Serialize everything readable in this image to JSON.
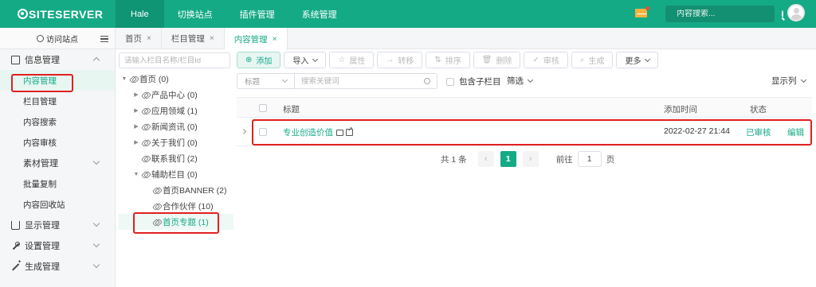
{
  "topbar": {
    "logo": "SITESERVER",
    "nav": [
      "Hale",
      "切换站点",
      "插件管理",
      "系统管理"
    ],
    "search_placeholder": "内容搜索..."
  },
  "sidebar": {
    "visit_site": "访问站点",
    "groups": [
      {
        "label": "信息管理",
        "icon": "edit-icon",
        "items": [
          "内容管理",
          "栏目管理",
          "内容搜索",
          "内容审核"
        ]
      },
      {
        "label": "素材管理",
        "icon": "",
        "items": [
          "批量复制",
          "内容回收站"
        ]
      },
      {
        "label": "显示管理",
        "icon": "shirt-icon"
      },
      {
        "label": "设置管理",
        "icon": "wrench-icon"
      },
      {
        "label": "生成管理",
        "icon": "magic-wand-icon"
      }
    ]
  },
  "tabs": [
    {
      "label": "首页",
      "close": "×"
    },
    {
      "label": "栏目管理",
      "close": "×"
    },
    {
      "label": "内容管理",
      "close": "×"
    }
  ],
  "tree": {
    "search_placeholder": "请输入栏目名称/栏目Id",
    "nodes": [
      {
        "label": "首页 (0)",
        "arrow": "▼"
      },
      {
        "label": "产品中心 (0)",
        "arrow": "▶"
      },
      {
        "label": "应用领域 (1)",
        "arrow": "▶"
      },
      {
        "label": "新闻资讯 (0)",
        "arrow": "▶"
      },
      {
        "label": "关于我们 (0)",
        "arrow": "▶"
      },
      {
        "label": "联系我们 (2)",
        "arrow": ""
      },
      {
        "label": "辅助栏目 (0)",
        "arrow": "▼"
      },
      {
        "label": "首页BANNER (2)",
        "arrow": ""
      },
      {
        "label": "合作伙伴 (10)",
        "arrow": ""
      },
      {
        "label": "首页专题 (1)",
        "arrow": ""
      }
    ]
  },
  "toolbar": {
    "add": "添加",
    "import": "导入",
    "attributes": "属性",
    "move": "转移",
    "sort": "排序",
    "delete": "删除",
    "audit": "审核",
    "generate": "生成",
    "more": "更多"
  },
  "filter": {
    "field_select": "标题",
    "keyword_placeholder": "搜索关键词",
    "include_sub": "包含子栏目",
    "filter_label": "筛选",
    "columns_label": "显示列"
  },
  "table": {
    "headers": {
      "title": "标题",
      "added_time": "添加时间",
      "status": "状态"
    },
    "rows": [
      {
        "title": "专业创造价值",
        "added_time": "2022-02-27 21:44",
        "status": "已审核",
        "action": "编辑"
      }
    ]
  },
  "pagination": {
    "total": "共 1 条",
    "prev": "‹",
    "current": "1",
    "next": "›",
    "goto_prefix": "前往",
    "goto_value": "1",
    "goto_suffix": "页"
  },
  "colors": {
    "brand": "#15aa86",
    "highlight": "#e02020"
  }
}
